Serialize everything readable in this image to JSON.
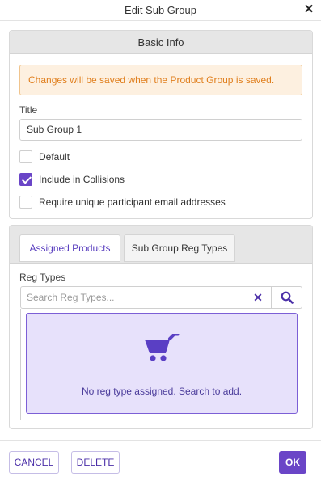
{
  "dialog": {
    "title": "Edit Sub Group",
    "close_icon": "close-icon"
  },
  "basic_info": {
    "heading": "Basic Info",
    "alert": "Changes will be saved when the Product Group is saved.",
    "title_label": "Title",
    "title_value": "Sub Group 1",
    "checkboxes": [
      {
        "label": "Default",
        "checked": false
      },
      {
        "label": "Include in Collisions",
        "checked": true
      },
      {
        "label": "Require unique participant email addresses",
        "checked": false
      }
    ]
  },
  "tabs": [
    {
      "label": "Assigned Products",
      "active": false
    },
    {
      "label": "Sub Group Reg Types",
      "active": true
    }
  ],
  "reg_types": {
    "label": "Reg Types",
    "search_placeholder": "Search Reg Types...",
    "clear_icon": "clear-icon",
    "search_icon": "search-icon",
    "empty_icon": "cart-icon",
    "empty_message": "No reg type assigned. Search to add."
  },
  "footer": {
    "cancel": "CANCEL",
    "delete": "DELETE",
    "ok": "OK"
  },
  "colors": {
    "accent": "#6a45c7",
    "alert_bg": "#fdf0e0",
    "alert_text": "#e07f1e",
    "empty_bg": "#e7e1fb"
  }
}
